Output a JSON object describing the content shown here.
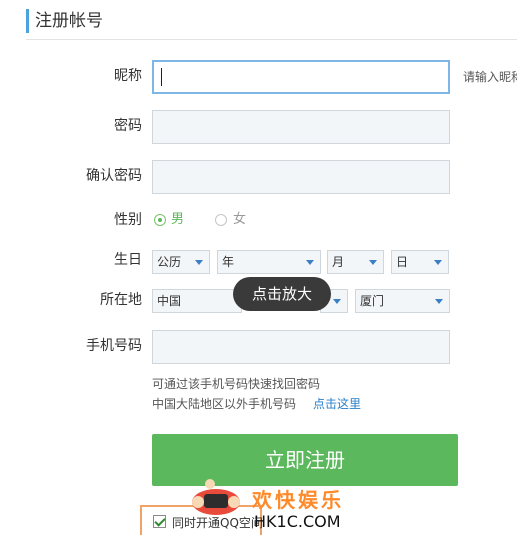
{
  "header": {
    "title": "注册帐号"
  },
  "form": {
    "nickname": {
      "label": "昵称",
      "value": "",
      "hint": "请输入昵称"
    },
    "password": {
      "label": "密码",
      "value": ""
    },
    "confirm_password": {
      "label": "确认密码",
      "value": ""
    },
    "gender": {
      "label": "性别",
      "options": [
        "男",
        "女"
      ],
      "selected": "男"
    },
    "birthday": {
      "label": "生日",
      "calendar": "公历",
      "year": "年",
      "month": "月",
      "day": "日"
    },
    "location": {
      "label": "所在地",
      "country": "中国",
      "city": "厦门"
    },
    "phone": {
      "label": "手机号码",
      "value": ""
    }
  },
  "notes": {
    "line1": "可通过该手机号码快速找回密码",
    "line2": "中国大陆地区以外手机号码",
    "link": "点击这里"
  },
  "tooltip": "点击放大",
  "submit": {
    "label": "立即注册"
  },
  "extra": {
    "checkbox_label": "同时开通QQ空间",
    "checked": true
  },
  "watermark": {
    "cn": "欢快娱乐",
    "en": "HK1C.COM"
  },
  "colors": {
    "accent": "#4aa3df",
    "button": "#5cb85c",
    "link": "#2a7fc9",
    "tooltip_bg": "#3a3a3a"
  }
}
